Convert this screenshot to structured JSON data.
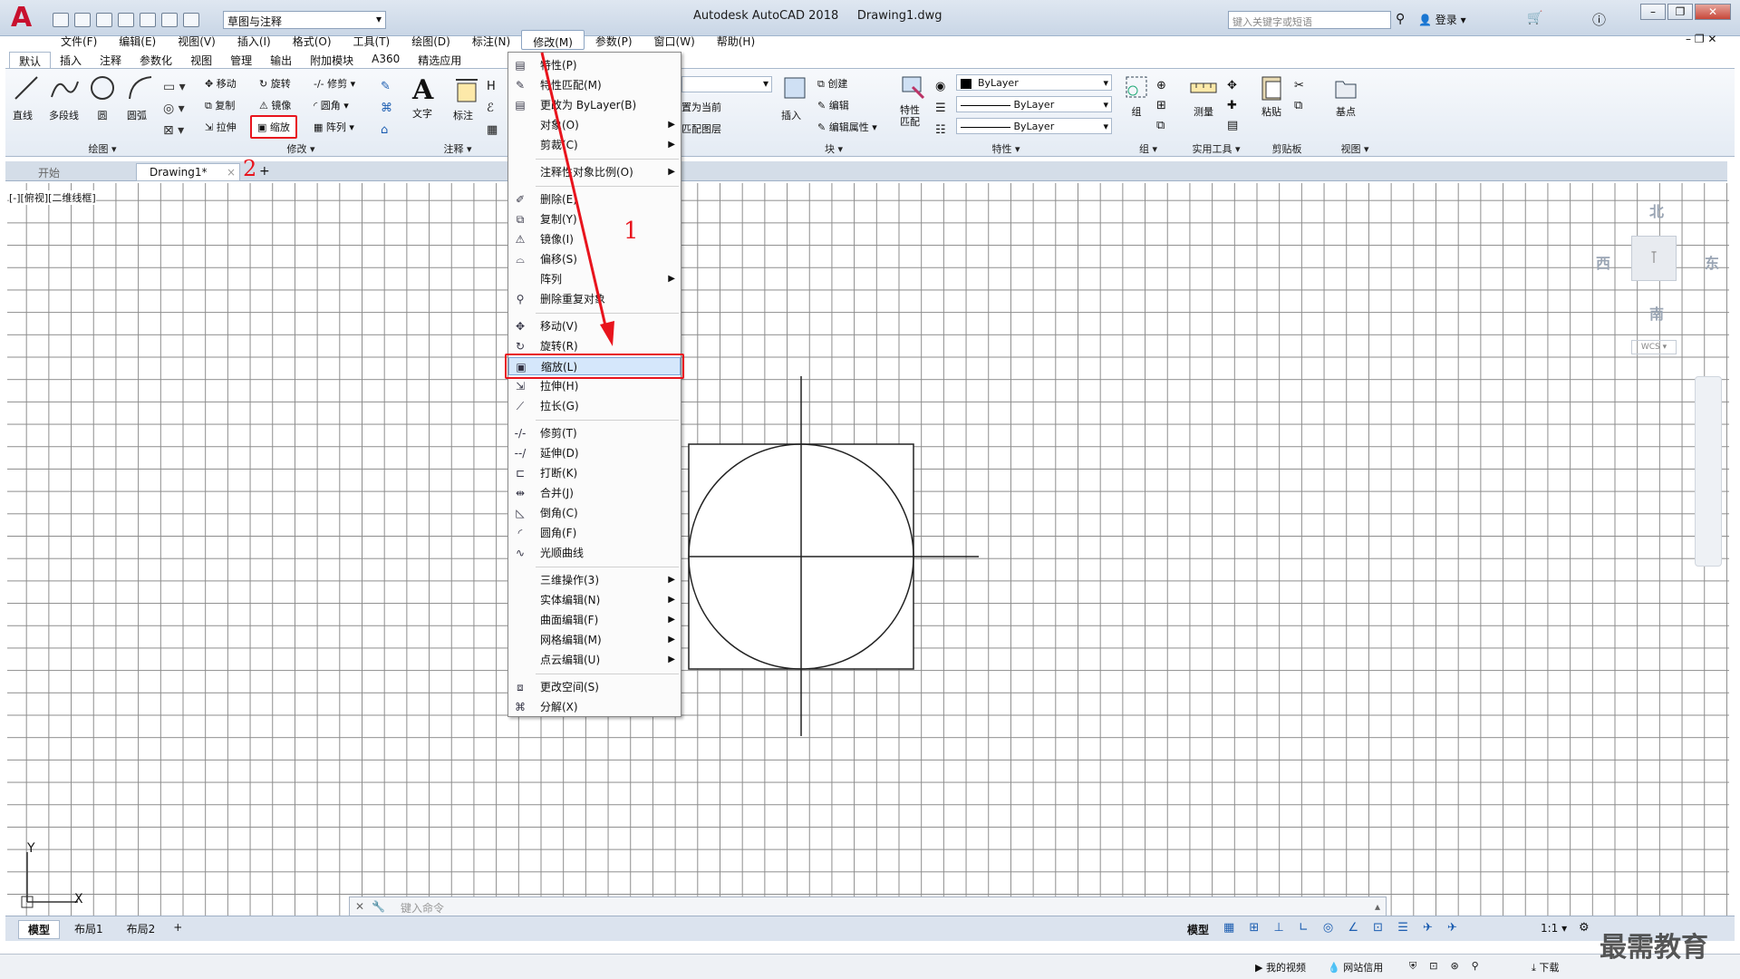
{
  "title": {
    "app": "Autodesk AutoCAD 2018",
    "document": "Drawing1.dwg",
    "workspace": "草图与注释",
    "search_placeholder": "键入关键字或短语",
    "login": "登录"
  },
  "menubar": [
    "文件(F)",
    "编辑(E)",
    "视图(V)",
    "插入(I)",
    "格式(O)",
    "工具(T)",
    "绘图(D)",
    "标注(N)",
    "修改(M)",
    "参数(P)",
    "窗口(W)",
    "帮助(H)"
  ],
  "ribbon_tabs": [
    "默认",
    "插入",
    "注释",
    "参数化",
    "视图",
    "管理",
    "输出",
    "附加模块",
    "A360",
    "精选应用"
  ],
  "ribbon": {
    "draw": {
      "line": "直线",
      "polyline": "多段线",
      "circle": "圆",
      "arc": "圆弧",
      "label": "绘图"
    },
    "modify": {
      "move": "移动",
      "rotate": "旋转",
      "trim": "修剪",
      "copy": "复制",
      "mirror": "镜像",
      "fillet": "圆角",
      "stretch": "拉伸",
      "scale": "缩放",
      "array": "阵列",
      "label": "修改"
    },
    "annotation": {
      "text": "文字",
      "dimension": "标注",
      "label": "注释"
    },
    "layers": {
      "set_current": "置为当前",
      "match_layer": "匹配图层"
    },
    "block": {
      "insert": "插入",
      "create": "创建",
      "edit": "编辑",
      "edit_attr": "编辑属性",
      "label": "块"
    },
    "properties": {
      "match": "特性匹配",
      "color": "ByLayer",
      "linetype": "ByLayer",
      "lineweight": "ByLayer",
      "label": "特性"
    },
    "groups": {
      "group": "组",
      "label": "组"
    },
    "utilities": {
      "measure": "测量",
      "label": "实用工具"
    },
    "clipboard": {
      "paste": "粘贴",
      "label": "剪贴板"
    },
    "view": {
      "base": "基点",
      "label": "视图"
    }
  },
  "doc_tabs": [
    "开始",
    "Drawing1*"
  ],
  "view_label": "[-][俯视][二维线框]",
  "annotations": {
    "n1": "1",
    "n2": "2"
  },
  "modify_menu": [
    {
      "label": "特性(P)",
      "icon": "properties-icon"
    },
    {
      "label": "特性匹配(M)",
      "icon": "match-properties-icon"
    },
    {
      "label": "更改为 ByLayer(B)",
      "icon": "bylayer-icon"
    },
    {
      "label": "对象(O)",
      "icon": "",
      "sub": true
    },
    {
      "label": "剪裁(C)",
      "icon": "",
      "sub": true
    },
    {
      "sep": true
    },
    {
      "label": "注释性对象比例(O)",
      "icon": "",
      "sub": true
    },
    {
      "sep": true
    },
    {
      "label": "删除(E)",
      "icon": "erase-icon"
    },
    {
      "label": "复制(Y)",
      "icon": "copy-icon"
    },
    {
      "label": "镜像(I)",
      "icon": "mirror-icon"
    },
    {
      "label": "偏移(S)",
      "icon": "offset-icon"
    },
    {
      "label": "阵列",
      "icon": "",
      "sub": true
    },
    {
      "label": "删除重复对象",
      "icon": "overkill-icon"
    },
    {
      "sep": true
    },
    {
      "label": "移动(V)",
      "icon": "move-icon"
    },
    {
      "label": "旋转(R)",
      "icon": "rotate-icon"
    },
    {
      "label": "缩放(L)",
      "icon": "scale-icon",
      "highlight": true
    },
    {
      "label": "拉伸(H)",
      "icon": "stretch-icon"
    },
    {
      "label": "拉长(G)",
      "icon": "lengthen-icon"
    },
    {
      "sep": true
    },
    {
      "label": "修剪(T)",
      "icon": "trim-icon"
    },
    {
      "label": "延伸(D)",
      "icon": "extend-icon"
    },
    {
      "label": "打断(K)",
      "icon": "break-icon"
    },
    {
      "label": "合并(J)",
      "icon": "join-icon"
    },
    {
      "label": "倒角(C)",
      "icon": "chamfer-icon"
    },
    {
      "label": "圆角(F)",
      "icon": "fillet-icon"
    },
    {
      "label": "光顺曲线",
      "icon": "blend-icon"
    },
    {
      "sep": true
    },
    {
      "label": "三维操作(3)",
      "icon": "",
      "sub": true
    },
    {
      "label": "实体编辑(N)",
      "icon": "",
      "sub": true
    },
    {
      "label": "曲面编辑(F)",
      "icon": "",
      "sub": true
    },
    {
      "label": "网格编辑(M)",
      "icon": "",
      "sub": true
    },
    {
      "label": "点云编辑(U)",
      "icon": "",
      "sub": true
    },
    {
      "sep": true
    },
    {
      "label": "更改空间(S)",
      "icon": "chspace-icon"
    },
    {
      "label": "分解(X)",
      "icon": "explode-icon"
    }
  ],
  "viewcube": {
    "north": "北",
    "south": "南",
    "east": "东",
    "west": "西",
    "wcs": "WCS"
  },
  "command_placeholder": "键入命令",
  "layout_tabs": [
    "模型",
    "布局1",
    "布局2"
  ],
  "status": {
    "model": "模型",
    "scale": "1:1"
  },
  "taskbar": {
    "video": "我的视频",
    "credit": "网站信用",
    "download": "下载"
  },
  "watermark": "最需教育",
  "ucs": {
    "x": "X",
    "y": "Y"
  }
}
